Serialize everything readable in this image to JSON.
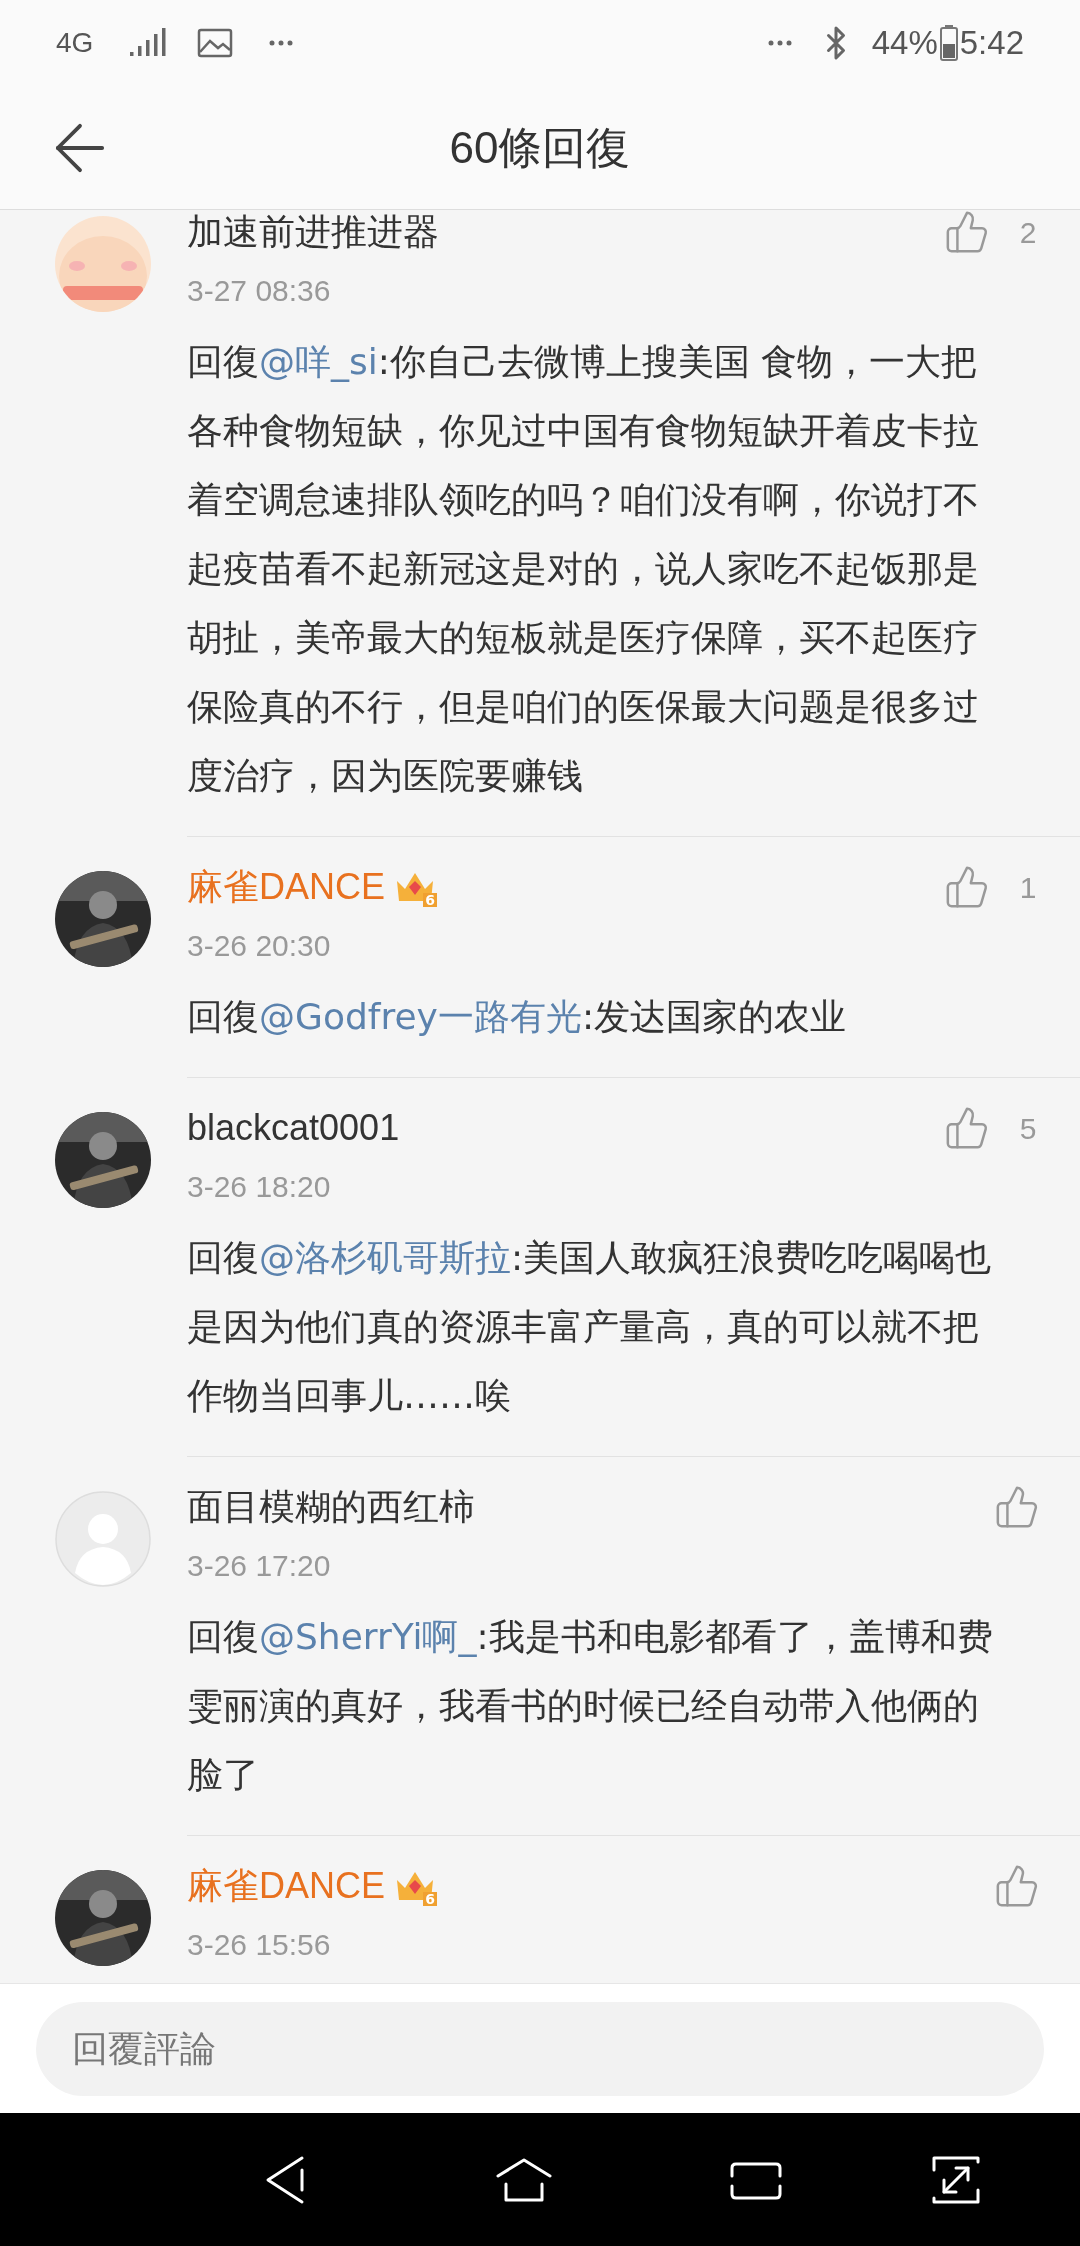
{
  "status_bar": {
    "network": "4G",
    "battery": "44%",
    "time": "5:42"
  },
  "header": {
    "title": "60條回復"
  },
  "comments": [
    {
      "name": "加速前进推进器",
      "vip": false,
      "time": "3-27 08:36",
      "likes": "2",
      "body": {
        "prefix": "回復",
        "mention": "@咩_si",
        "text": ":你自己去微博上搜美国 食物，一大把各种食物短缺，你见过中国有食物短缺开着皮卡拉着空调怠速排队领吃的吗？咱们没有啊，你说打不起疫苗看不起新冠这是对的，说人家吃不起饭那是胡扯，美帝最大的短板就是医疗保障，买不起医疗保险真的不行，但是咱们的医保最大问题是很多过度治疗，因为医院要赚钱"
      }
    },
    {
      "name": "麻雀DANCE",
      "vip": true,
      "vip_level": "6",
      "time": "3-26 20:30",
      "likes": "1",
      "body": {
        "prefix": "回復",
        "mention": "@Godfrey一路有光",
        "text": ":发达国家的农业"
      }
    },
    {
      "name": "blackcat0001",
      "vip": false,
      "time": "3-26 18:20",
      "likes": "5",
      "body": {
        "prefix": "回復",
        "mention": "@洛杉矶哥斯拉",
        "text": ":美国人敢疯狂浪费吃吃喝喝也是因为他们真的资源丰富产量高，真的可以就不把作物当回事儿……唉"
      }
    },
    {
      "avatar": {
        "kind": "placeholder"
      },
      "name": "面目模糊的西红柿",
      "vip": false,
      "time": "3-26 17:20",
      "body": {
        "prefix": "回復",
        "mention": "@SherrYi啊_",
        "text": ":我是书和电影都看了，盖博和费雯丽演的真好，我看书的时候已经自动带入他俩的脸了"
      }
    },
    {
      "name": "麻雀DANCE",
      "vip": true,
      "vip_level": "6",
      "time": "3-26 15:56"
    }
  ],
  "reply_field": {
    "placeholder": "回覆評論"
  }
}
